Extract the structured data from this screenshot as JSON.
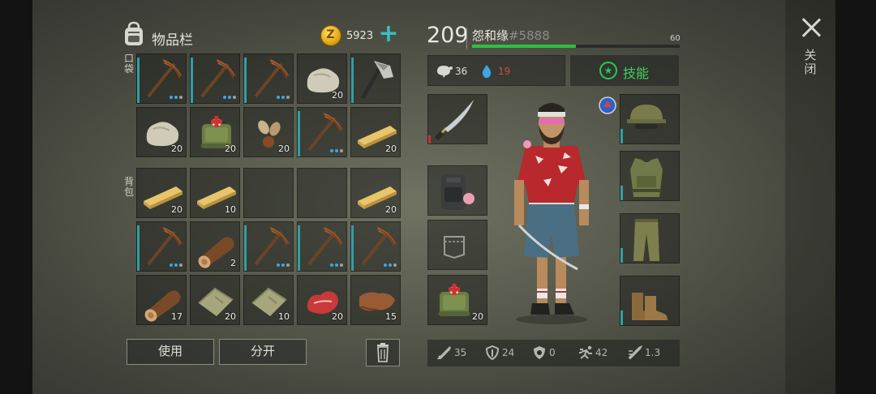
{
  "inventory": {
    "title": "物品栏",
    "coins": "5923",
    "coin_icon_letter": "Z",
    "pocket_label": "口袋",
    "backpack_label": "背包",
    "pocket_slots": [
      {
        "icon": "pickaxe-icon",
        "count": ""
      },
      {
        "icon": "pickaxe-icon",
        "count": ""
      },
      {
        "icon": "pickaxe-icon",
        "count": ""
      },
      {
        "icon": "stone-icon",
        "count": "20"
      },
      {
        "icon": "hatchet-icon",
        "count": ""
      },
      {
        "icon": "stone-icon",
        "count": "20"
      },
      {
        "icon": "medkit-icon",
        "count": "20"
      },
      {
        "icon": "seeds-icon",
        "count": "20"
      },
      {
        "icon": "pickaxe-icon",
        "count": ""
      },
      {
        "icon": "wood-plank-icon",
        "count": "20"
      }
    ],
    "backpack_slots": [
      {
        "icon": "wood-plank-icon",
        "count": "20"
      },
      {
        "icon": "wood-plank-icon",
        "count": "10"
      },
      {
        "icon": "empty",
        "count": ""
      },
      {
        "icon": "empty",
        "count": ""
      },
      {
        "icon": "wood-plank-icon",
        "count": "20"
      },
      {
        "icon": "pickaxe-icon",
        "count": ""
      },
      {
        "icon": "log-icon",
        "count": "2"
      },
      {
        "icon": "pickaxe-icon",
        "count": ""
      },
      {
        "icon": "pickaxe-icon",
        "count": ""
      },
      {
        "icon": "pickaxe-icon",
        "count": ""
      },
      {
        "icon": "log-icon",
        "count": "17"
      },
      {
        "icon": "cloth-icon",
        "count": "20"
      },
      {
        "icon": "cloth-icon",
        "count": "10"
      },
      {
        "icon": "raw-meat-icon",
        "count": "20"
      },
      {
        "icon": "leather-icon",
        "count": "15"
      }
    ],
    "use_label": "使用",
    "split_label": "分开"
  },
  "character": {
    "level": "209",
    "name": "怨和缘",
    "tag": "#5888",
    "xp_max": "60",
    "xp_fraction": 0.5,
    "hunger": "36",
    "thirst": "19",
    "skills_label": "技能",
    "left_equipment": [
      {
        "icon": "katana-icon",
        "count": ""
      },
      {
        "icon": "backpack-icon",
        "count": ""
      },
      {
        "icon": "pocket-icon",
        "count": ""
      },
      {
        "icon": "medkit-icon",
        "count": "20"
      }
    ],
    "right_equipment": [
      {
        "icon": "helmet-icon"
      },
      {
        "icon": "vest-icon"
      },
      {
        "icon": "pants-icon"
      },
      {
        "icon": "boots-icon"
      }
    ],
    "stats": {
      "attack": "35",
      "defense": "24",
      "toxic": "0",
      "speed": "42",
      "attack_speed": "1.3"
    }
  },
  "close_label": "关闭",
  "colors": {
    "accent_teal": "#39c0c0",
    "xp_green": "#2fbf3f",
    "skills_green": "#40d05e",
    "thirst_red": "#d94a3a"
  }
}
